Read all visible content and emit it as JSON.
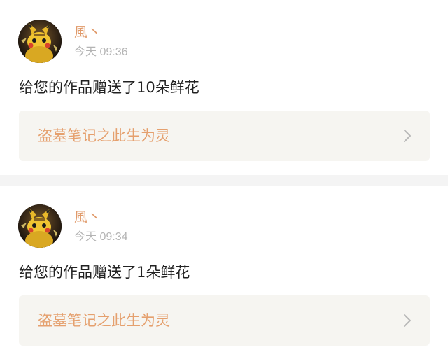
{
  "notifications": [
    {
      "username": "風丶",
      "time": "今天 09:36",
      "message": "给您的作品赠送了10朵鲜花",
      "work_title": "盗墓笔记之此生为灵"
    },
    {
      "username": "風丶",
      "time": "今天 09:34",
      "message": "给您的作品赠送了1朵鲜花",
      "work_title": "盗墓笔记之此生为灵"
    }
  ],
  "colors": {
    "username": "#e09a6a",
    "work_title": "#e5a06e",
    "timestamp": "#b4b4b4",
    "card_bg": "#f6f5f1",
    "divider": "#f4f4f4"
  },
  "icons": {
    "avatar": "pikachu-avatar-icon",
    "chevron": "chevron-right-icon"
  }
}
